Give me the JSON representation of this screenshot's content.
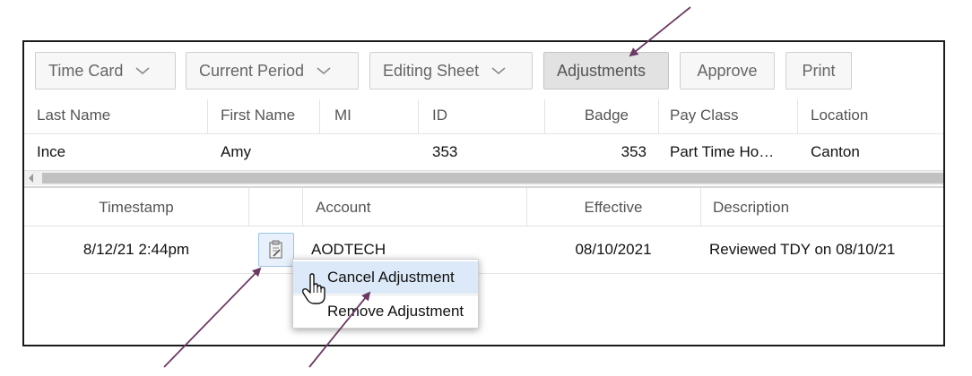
{
  "toolbar": {
    "time_card": "Time Card",
    "current_period": "Current Period",
    "editing_sheet": "Editing Sheet",
    "adjustments": "Adjustments",
    "approve": "Approve",
    "print": "Print"
  },
  "employee_table": {
    "headers": [
      "Last Name",
      "First Name",
      "MI",
      "ID",
      "Badge",
      "Pay Class",
      "Location"
    ],
    "row": [
      "Ince",
      "Amy",
      "",
      "353",
      "353",
      "Part Time Ho…",
      "Canton"
    ]
  },
  "adjustment_table": {
    "headers": [
      "Timestamp",
      "",
      "Account",
      "Effective",
      "Description"
    ],
    "row": {
      "timestamp": "8/12/21 2:44pm",
      "account": "AODTECH",
      "effective": "08/10/2021",
      "description": "Reviewed TDY on 08/10/21"
    }
  },
  "context_menu": {
    "items": [
      "Cancel Adjustment",
      "Remove Adjustment"
    ]
  },
  "icons": {
    "chevron": "chevron-down-icon",
    "note": "notepad-edit-icon",
    "cursor": "hand-pointer-icon"
  },
  "colors": {
    "annotation_arrow": "#6b3a63",
    "menu_highlight": "#dbe9f8"
  }
}
